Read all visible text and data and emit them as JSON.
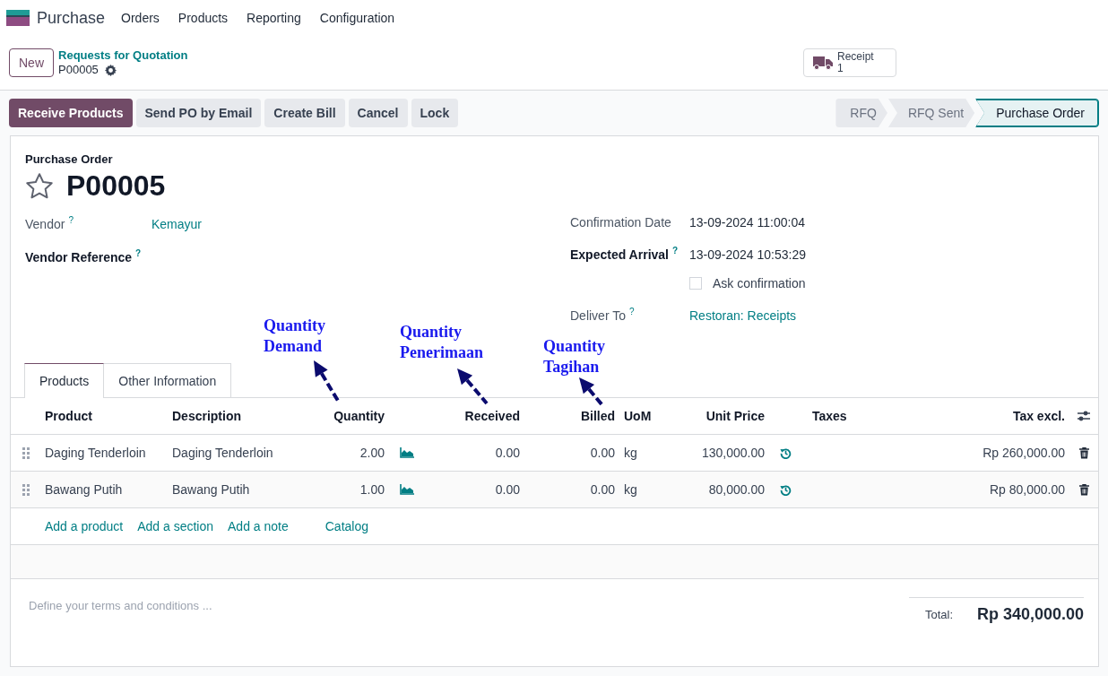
{
  "app": {
    "name": "Purchase",
    "menu": [
      "Orders",
      "Products",
      "Reporting",
      "Configuration"
    ]
  },
  "control_panel": {
    "new_button": "New",
    "breadcrumb": "Requests for Quotation",
    "record": "P00005",
    "smart_button": {
      "label": "Receipt",
      "count": "1"
    }
  },
  "actions": [
    {
      "label": "Receive Products",
      "kind": "primary"
    },
    {
      "label": "Send PO by Email",
      "kind": "secondary"
    },
    {
      "label": "Create Bill",
      "kind": "secondary"
    },
    {
      "label": "Cancel",
      "kind": "secondary"
    },
    {
      "label": "Lock",
      "kind": "secondary"
    }
  ],
  "stages": [
    {
      "label": "RFQ",
      "selected": false
    },
    {
      "label": "RFQ Sent",
      "selected": false
    },
    {
      "label": "Purchase Order",
      "selected": true
    }
  ],
  "form": {
    "subtitle": "Purchase Order",
    "title": "P00005",
    "favorite": false,
    "left_fields": [
      {
        "label": "Vendor",
        "help": "?",
        "value": "Kemayur",
        "required": false,
        "link": true
      },
      {
        "label": "Vendor Reference",
        "help": "?",
        "required": true
      }
    ],
    "right_fields": [
      {
        "label": "Confirmation Date",
        "value": "13-09-2024 11:00:04",
        "required": false,
        "link": false
      },
      {
        "label": "Expected Arrival",
        "help": "?",
        "value": "13-09-2024 10:53:29",
        "required": true,
        "link": false
      },
      {
        "checkbox": "Ask confirmation",
        "checked": false
      },
      {
        "label": "Deliver To",
        "help": "?",
        "value": "Restoran: Receipts",
        "required": false,
        "link": true
      }
    ]
  },
  "tabs": [
    {
      "label": "Products",
      "selected": true
    },
    {
      "label": "Other Information",
      "selected": false
    }
  ],
  "table": {
    "columns": [
      "Product",
      "Description",
      "Quantity",
      "Received",
      "Billed",
      "UoM",
      "Unit Price",
      "Taxes",
      "Tax excl."
    ],
    "rows": [
      {
        "product": "Daging Tenderloin",
        "description": "Daging Tenderloin",
        "quantity": "2.00",
        "received": "0.00",
        "billed": "0.00",
        "uom": "kg",
        "unit_price": "130,000.00",
        "subtotal": "Rp 260,000.00"
      },
      {
        "product": "Bawang Putih",
        "description": "Bawang Putih",
        "quantity": "1.00",
        "received": "0.00",
        "billed": "0.00",
        "uom": "kg",
        "unit_price": "80,000.00",
        "subtotal": "Rp 80,000.00"
      }
    ],
    "add_links": [
      "Add a product",
      "Add a section",
      "Add a note",
      "Catalog"
    ]
  },
  "terms_placeholder": "Define your terms and conditions ...",
  "total": {
    "label": "Total:",
    "value": "Rp 340,000.00"
  },
  "annotations": [
    {
      "text": "Quantity Demand"
    },
    {
      "text": "Quantity Penerimaan"
    },
    {
      "text": "Quantity Tagihan"
    }
  ]
}
